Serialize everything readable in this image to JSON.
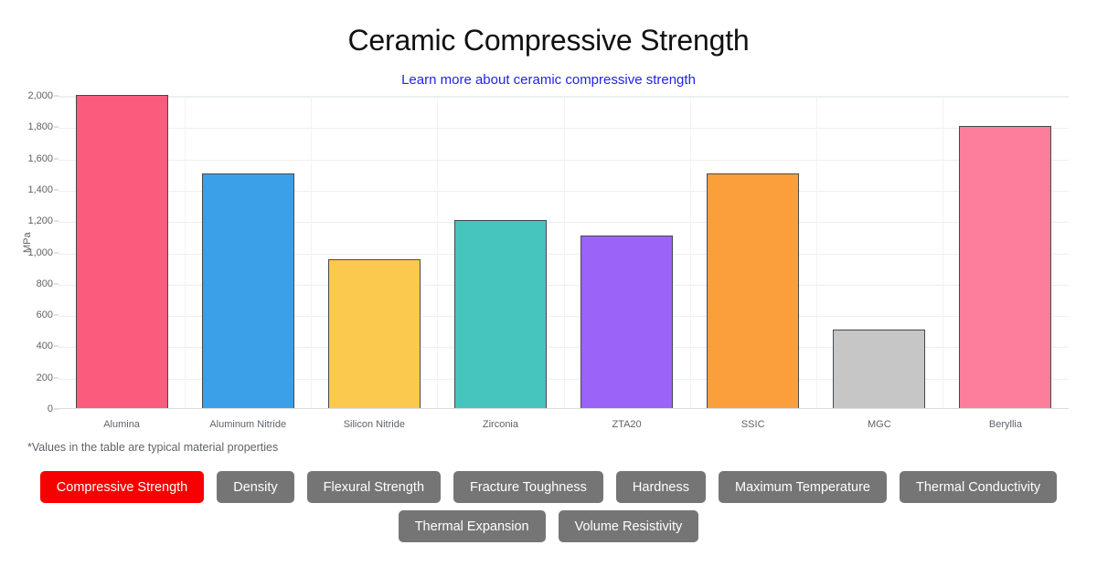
{
  "header": {
    "title": "Ceramic Compressive Strength",
    "subtitle_link": "Learn more about ceramic compressive strength",
    "link_color": "#2222ee"
  },
  "footnote": "*Values in the table are typical material properties",
  "chart_data": {
    "type": "bar",
    "title": "Ceramic Compressive Strength",
    "xlabel": "",
    "ylabel": "MPa",
    "ylim": [
      0,
      2000
    ],
    "ytick_step": 200,
    "yticks": [
      "0",
      "200",
      "400",
      "600",
      "800",
      "1,000",
      "1,200",
      "1,400",
      "1,600",
      "1,800",
      "2,000"
    ],
    "grid": true,
    "legend": "none",
    "categories": [
      "Alumina",
      "Aluminum Nitride",
      "Silicon Nitride",
      "Zirconia",
      "ZTA20",
      "SSIC",
      "MGC",
      "Beryllia"
    ],
    "values": [
      2000,
      1500,
      950,
      1200,
      1100,
      1500,
      500,
      1800
    ],
    "bar_colors": [
      "#fb5b7c",
      "#3ba0e8",
      "#fbc94e",
      "#46c4be",
      "#9b63f8",
      "#fb9e3c",
      "#c6c6c6",
      "#fc7e9c"
    ],
    "bar_border_color": "#444a4f"
  },
  "property_tabs": {
    "active_color": "#f60000",
    "inactive_color": "#757575",
    "row1": [
      {
        "label": "Compressive Strength",
        "active": true
      },
      {
        "label": "Density",
        "active": false
      },
      {
        "label": "Flexural Strength",
        "active": false
      },
      {
        "label": "Fracture Toughness",
        "active": false
      },
      {
        "label": "Hardness",
        "active": false
      },
      {
        "label": "Maximum Temperature",
        "active": false
      },
      {
        "label": "Thermal Conductivity",
        "active": false
      }
    ],
    "row2": [
      {
        "label": "Thermal Expansion",
        "active": false
      },
      {
        "label": "Volume Resistivity",
        "active": false
      }
    ]
  }
}
